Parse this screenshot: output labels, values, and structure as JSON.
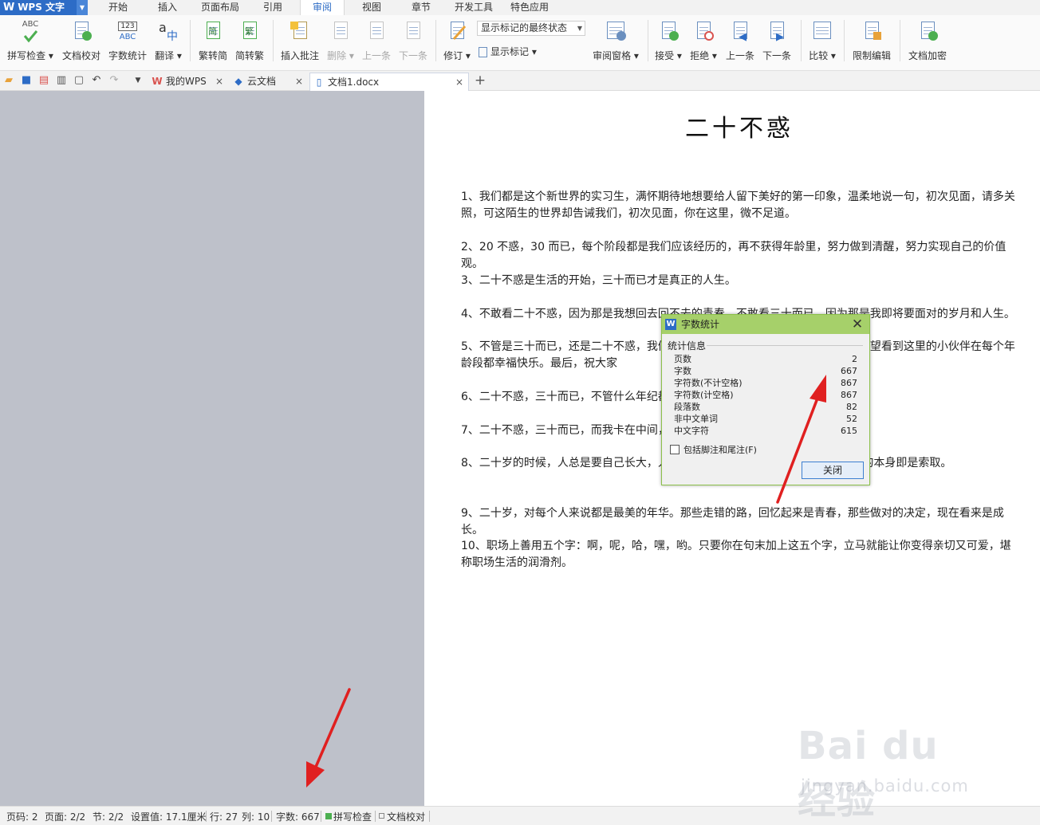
{
  "app": {
    "name": "WPS 文字"
  },
  "menu": {
    "tabs": [
      "开始",
      "插入",
      "页面布局",
      "引用",
      "审阅",
      "视图",
      "章节",
      "开发工具",
      "特色应用"
    ],
    "active": "审阅"
  },
  "ribbon": {
    "spell_check": "拼写检查",
    "doc_proof": "文档校对",
    "word_count": "字数统计",
    "translate": "翻译",
    "trad_to_simp": "繁转简",
    "simp_to_trad": "简转繁",
    "insert_comment": "插入批注",
    "delete": "删除",
    "prev_item": "上一条",
    "next_item": "下一条",
    "track_changes": "修订",
    "markup_mode": "显示标记的最终状态",
    "show_markup": "显示标记",
    "review_pane": "审阅窗格",
    "accept": "接受",
    "reject": "拒绝",
    "prev_change": "上一条",
    "next_change": "下一条",
    "compare": "比较",
    "restrict_edit": "限制编辑",
    "encrypt": "文档加密",
    "icon_text_abc": "ABC",
    "icon_text_123": "123",
    "icon_text_a": "a",
    "icon_text_zh": "中",
    "icon_text_jian": "简",
    "icon_text_fan": "繁"
  },
  "tabs": [
    {
      "label": "我的WPS",
      "icon": "wps-icon"
    },
    {
      "label": "云文档",
      "icon": "cloud-cube-icon"
    },
    {
      "label": "文档1.docx",
      "icon": "document-icon"
    }
  ],
  "document": {
    "title": "二十不惑",
    "paragraphs": [
      "1、我们都是这个新世界的实习生，满怀期待地想要给人留下美好的第一印象，温柔地说一句，初次见面，请多关照，可这陌生的世界却告诫我们，初次见面，你在这里，微不足道。",
      "2、20 不惑，30 而已，每个阶段都是我们应该经历的，再不获得年龄里，努力做到清醒，努力实现自己的价值观。",
      "3、二十不惑是生活的开始，三十而已才是真正的人生。",
      "4、不敢看二十不惑，因为那是我想回去回不去的青春。不敢看三十而已，因为那是我即将要面对的岁月和人生。",
      "5、不管是三十而已，还是二十不惑，我们都要努力，因为我们每个人都不容易。希望看到这里的小伙伴在每个年龄段都幸福快乐。最后，祝大家",
      "6、二十不惑，三十而已，不管什么年纪都要，活成自己喜欢的样子。",
      "7、二十不惑，三十而已，而我卡在中间，",
      "8、二十岁的时候，人总是要自己长大，人                                聪明白爱的代价之所以为代价，因为爱的本身即是索取。",
      "9、二十岁，对每个人来说都是最美的年华。那些走错的路，回忆起来是青春，那些做对的决定，现在看来是成长。",
      "10、职场上善用五个字：啊，呢，哈，嘿，哟。只要你在句末加上这五个字，立马就能让你变得亲切又可爱，堪称职场生活的润滑剂。"
    ]
  },
  "dialog": {
    "title": "字数统计",
    "group_label": "统计信息",
    "rows": [
      {
        "label": "页数",
        "value": "2"
      },
      {
        "label": "字数",
        "value": "667"
      },
      {
        "label": "字符数(不计空格)",
        "value": "867"
      },
      {
        "label": "字符数(计空格)",
        "value": "867"
      },
      {
        "label": "段落数",
        "value": "82"
      },
      {
        "label": "非中文单词",
        "value": "52"
      },
      {
        "label": "中文字符",
        "value": "615"
      }
    ],
    "checkbox_label": "包括脚注和尾注(F)",
    "checkbox_checked": false,
    "close_button": "关闭"
  },
  "statusbar": {
    "page_num": "页码: 2",
    "pages": "页面: 2/2",
    "section": "节: 2/2",
    "setting": "设置值: 17.1厘米",
    "row": "行: 27",
    "col": "列: 10",
    "word_count": "字数: 667",
    "spell_check": "拼写检查",
    "doc_proof": "文档校对"
  },
  "watermark": {
    "line1": "Bai du 经验",
    "line2": "jingyan.baidu.com"
  },
  "colors": {
    "accent": "#2d6cc6",
    "dialog_title": "#a6d06a",
    "annotation_arrow": "#e02020",
    "workspace": "#bec1ca"
  }
}
